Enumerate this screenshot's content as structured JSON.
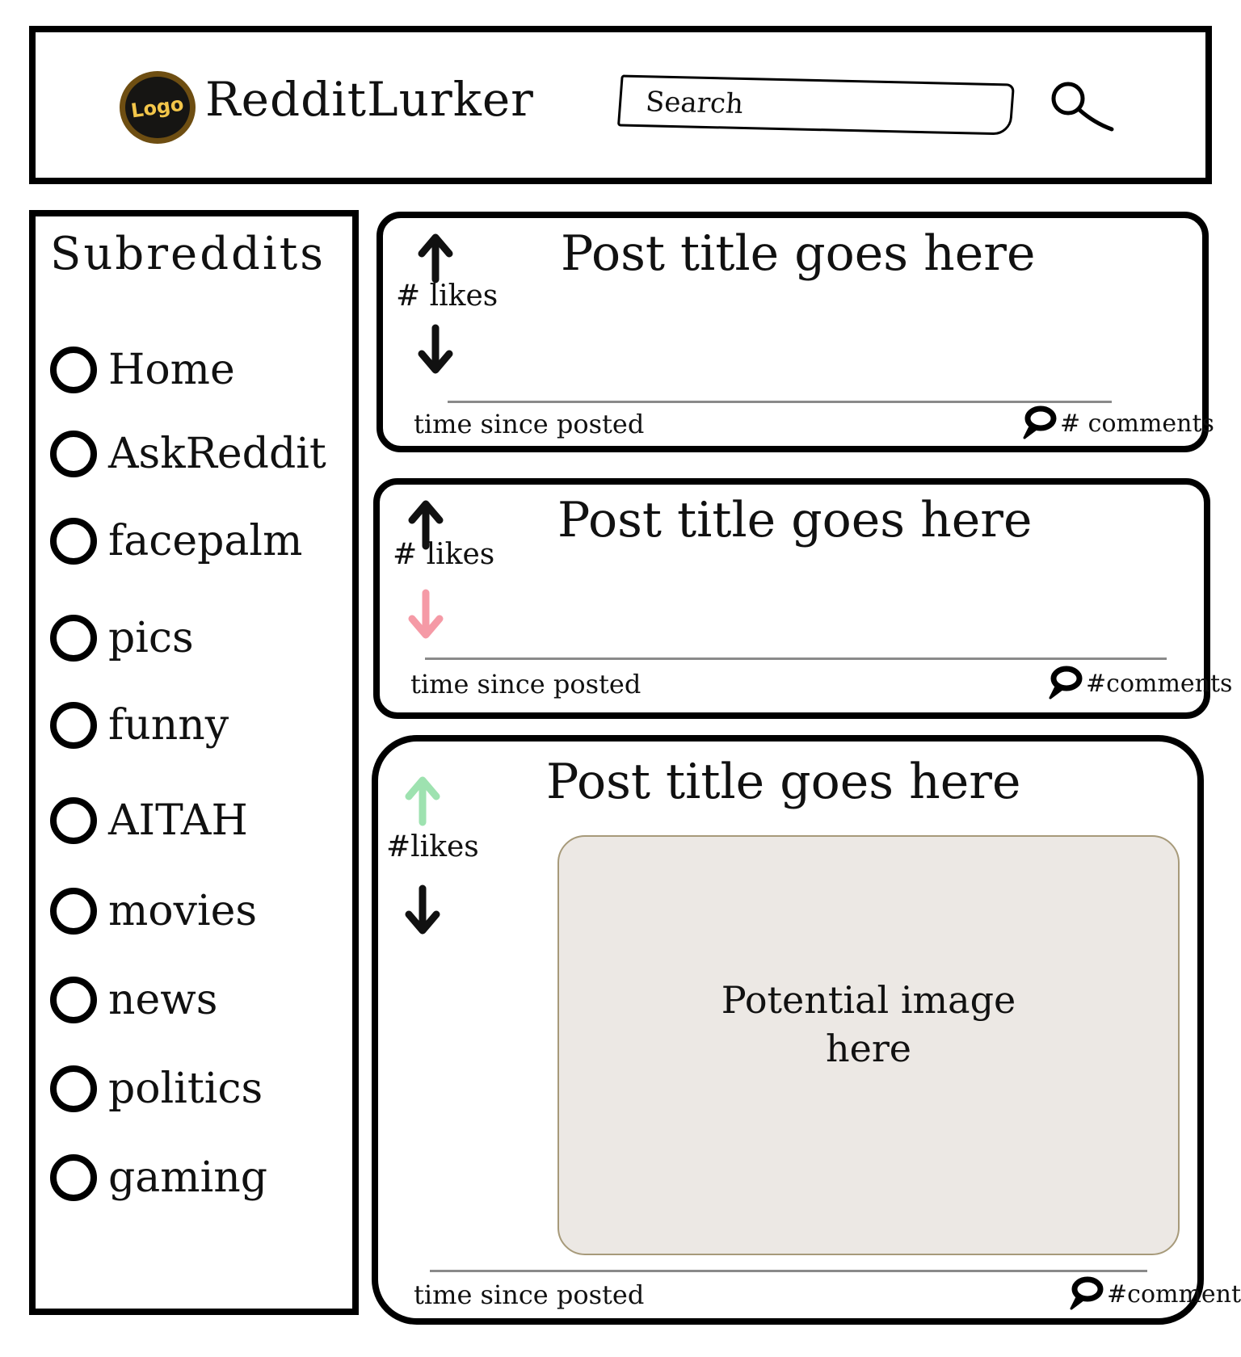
{
  "header": {
    "logo_text": "Logo",
    "app_title": "RedditLurker",
    "search": {
      "placeholder": "Search",
      "icon": "magnifier-icon"
    }
  },
  "sidebar": {
    "title": "Subreddits",
    "items": [
      {
        "label": "Home"
      },
      {
        "label": "AskReddit"
      },
      {
        "label": "facepalm"
      },
      {
        "label": "pics"
      },
      {
        "label": "funny"
      },
      {
        "label": "AITAH"
      },
      {
        "label": "movies"
      },
      {
        "label": "news"
      },
      {
        "label": "politics"
      },
      {
        "label": "gaming"
      }
    ]
  },
  "posts": [
    {
      "title": "Post title goes here",
      "likes": "# likes",
      "time": "time since posted",
      "comments": "# comments",
      "vote_state": "none",
      "up_color": "#111111",
      "down_color": "#111111"
    },
    {
      "title": "Post title goes here",
      "likes": "# likes",
      "time": "time since posted",
      "comments": "#comments",
      "vote_state": "downvoted",
      "up_color": "#111111",
      "down_color": "#f59aa6"
    },
    {
      "title": "Post title goes here",
      "likes": "#likes",
      "time": "time since posted",
      "comments": "#comments",
      "vote_state": "upvoted",
      "up_color": "#9ee2b0",
      "down_color": "#111111",
      "image_caption": "Potential image here"
    }
  ],
  "colors": {
    "logo_bg": "#161513",
    "logo_ring": "#6e4e12",
    "logo_text": "#f3c64a",
    "image_bg": "#ece8e4",
    "upvote_active": "#9ee2b0",
    "downvote_active": "#f59aa6"
  }
}
